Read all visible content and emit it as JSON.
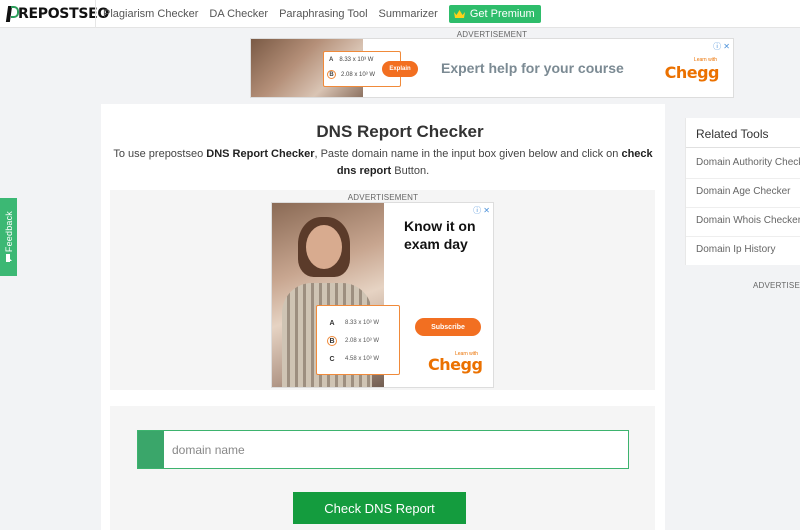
{
  "brand": {
    "name": "REPOSTSEO"
  },
  "nav": {
    "links": [
      "Plagiarism Checker",
      "DA Checker",
      "Paraphrasing Tool",
      "Summarizer"
    ],
    "premium_label": "Get Premium"
  },
  "ads": {
    "label": "ADVERTISEMENT",
    "top": {
      "headline": "Expert help for your course",
      "button": "Explain",
      "brand": "Chegg",
      "tagline": "Learn with",
      "options": [
        {
          "letter": "A",
          "text": "8.33 x 10³ W"
        },
        {
          "letter": "B",
          "text": "2.08 x 10³ W"
        }
      ]
    },
    "middle": {
      "headline": "Know it on exam day",
      "button": "Subscribe",
      "brand": "Chegg",
      "tagline": "Learn with",
      "options": [
        {
          "letter": "A",
          "text": "8.33 x 10³ W"
        },
        {
          "letter": "B",
          "text": "2.08 x 10³ W"
        },
        {
          "letter": "C",
          "text": "4.58 x 10³ W"
        }
      ]
    },
    "sidebar_label": "ADVERTISEMENT"
  },
  "main": {
    "title": "DNS Report Checker",
    "intro": {
      "part1": "To use prepostseo ",
      "bold1": "DNS Report Checker",
      "part2": ", Paste domain name in the input box given below and click on ",
      "bold2": "check dns report",
      "part3": " Button."
    },
    "input": {
      "placeholder": "domain name",
      "value": ""
    },
    "button_label": "Check DNS Report"
  },
  "sidebar": {
    "title": "Related Tools",
    "items": [
      "Domain Authority Checker",
      "Domain Age Checker",
      "Domain Whois Checker",
      "Domain Ip History"
    ]
  },
  "feedback": {
    "label": "Feedback"
  },
  "colors": {
    "accent_green": "#2ebd6b",
    "button_green": "#149c3e",
    "chegg_orange": "#eb7100"
  }
}
